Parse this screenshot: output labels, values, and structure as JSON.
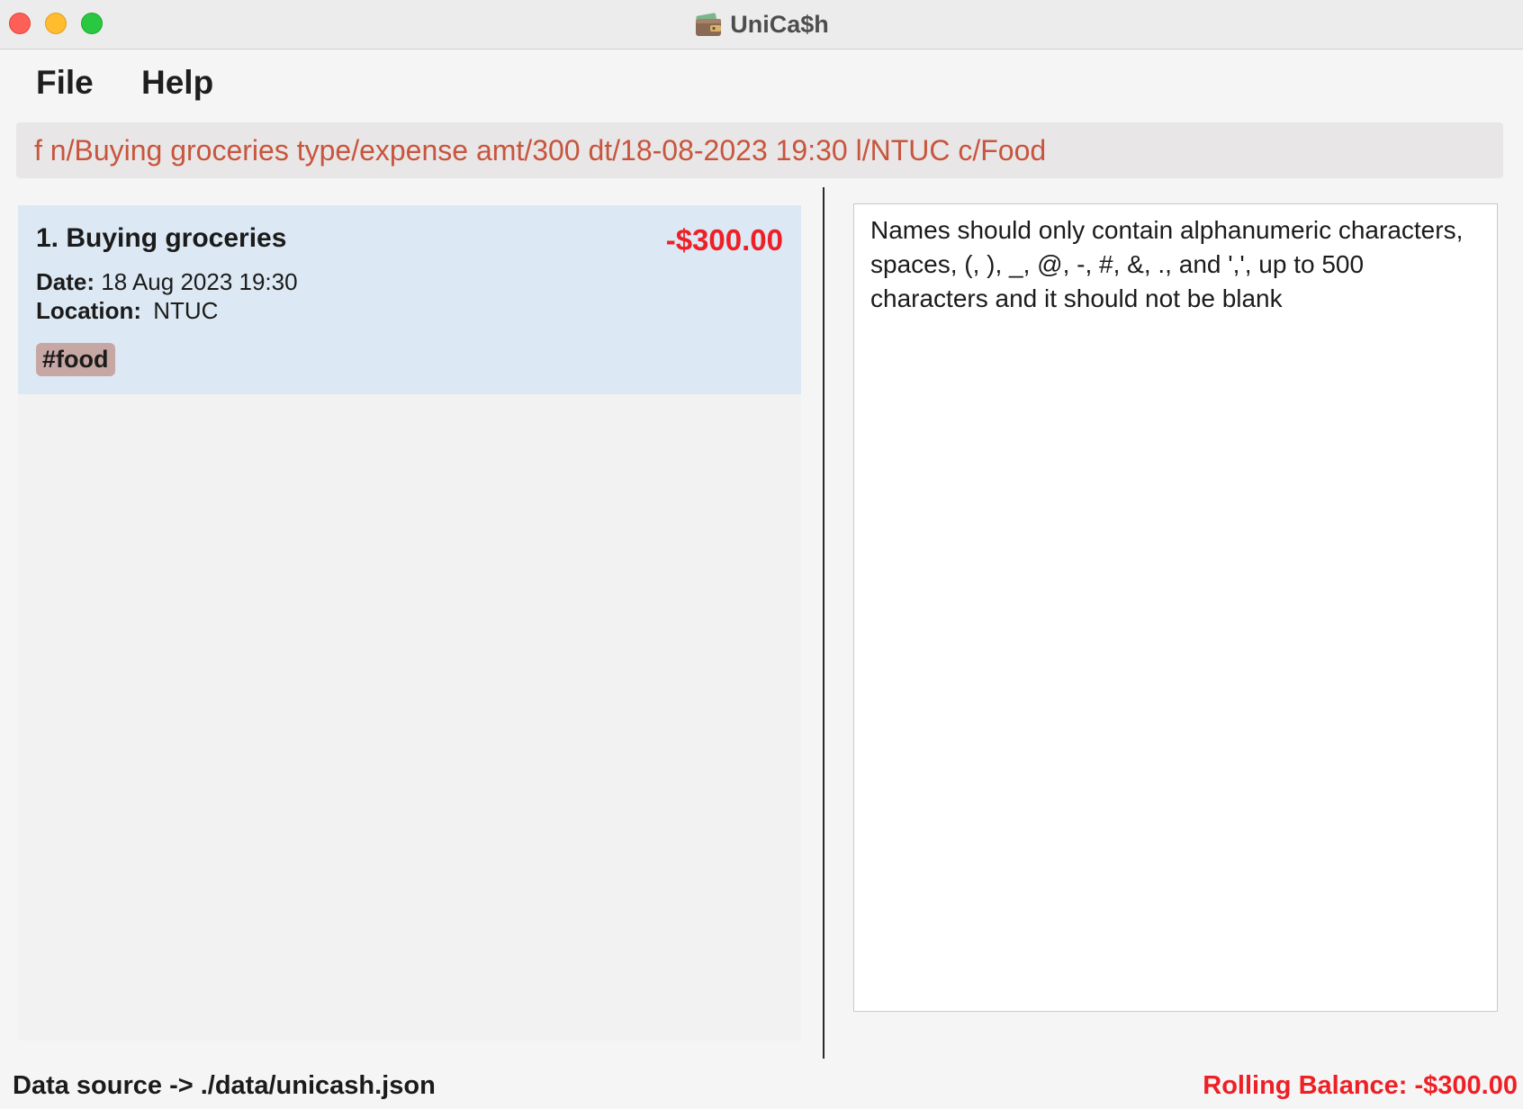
{
  "window": {
    "title": "UniCa$h",
    "app_icon": "wallet-icon"
  },
  "menu": {
    "file_label": "File",
    "help_label": "Help"
  },
  "command": {
    "value": "f n/Buying groceries type/expense amt/300 dt/18-08-2023 19:30 l/NTUC c/Food",
    "text_color": "#c8553d"
  },
  "transactions": [
    {
      "index_title": "1. Buying groceries",
      "amount": "-$300.00",
      "date_label": "Date:",
      "date_value": "18 Aug 2023 19:30",
      "location_label": "Location:",
      "location_value": "NTUC",
      "category_tag": "#food"
    }
  ],
  "result": {
    "message": "Names should only contain alphanumeric characters, spaces, (, ), _, @, -, #, &, ., and ',', up to 500 characters and it should not be blank"
  },
  "status": {
    "data_source": "Data source -> ./data/unicash.json",
    "rolling_balance": "Rolling Balance: -$300.00"
  },
  "colors": {
    "expense_red": "#ee1f25",
    "card_bg": "#dce8f3",
    "tag_bg": "#c7a7a3"
  }
}
